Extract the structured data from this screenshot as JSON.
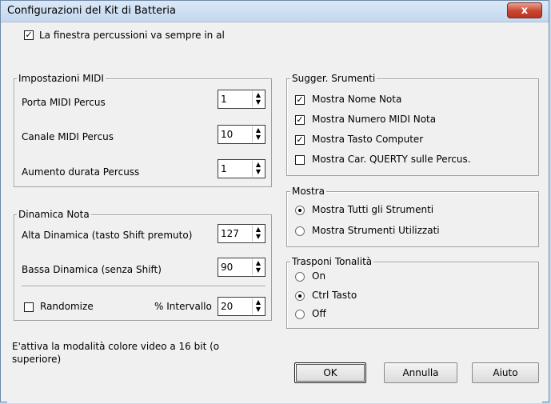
{
  "window": {
    "title": "Configurazioni del Kit di Batteria",
    "close_icon": "x"
  },
  "top_checkbox": {
    "label": "La finestra percussioni va sempre in al",
    "checked": true
  },
  "midi": {
    "legend": "Impostazioni MIDI",
    "port_label": "Porta MIDI Percus",
    "port_value": "1",
    "channel_label": "Canale MIDI Percus",
    "channel_value": "10",
    "duration_label": "Aumento durata Percuss",
    "duration_value": "1"
  },
  "dynamics": {
    "legend": "Dinamica Nota",
    "high_label": "Alta Dinamica (tasto Shift premuto)",
    "high_value": "127",
    "low_label": "Bassa Dinamica (senza Shift)",
    "low_value": "90",
    "randomize_label": "Randomize",
    "randomize_checked": false,
    "interval_label": "% Intervallo",
    "interval_value": "20"
  },
  "tips": {
    "legend": "Sugger. Srumenti",
    "items": [
      {
        "label": "Mostra Nome Nota",
        "checked": true
      },
      {
        "label": "Mostra Numero MIDI Nota",
        "checked": true
      },
      {
        "label": "Mostra Tasto Computer",
        "checked": true
      },
      {
        "label": "Mostra Car. QUERTY sulle Percus.",
        "checked": false
      }
    ]
  },
  "show": {
    "legend": "Mostra",
    "options": [
      {
        "label": "Mostra Tutti gli Strumenti",
        "selected": true
      },
      {
        "label": "Mostra Strumenti Utilizzati",
        "selected": false
      }
    ]
  },
  "transpose": {
    "legend": "Trasponi Tonalità",
    "options": [
      {
        "label": "On",
        "selected": false
      },
      {
        "label": "Ctrl Tasto",
        "selected": true
      },
      {
        "label": "Off",
        "selected": false
      }
    ]
  },
  "note": "E'attiva la modalità colore video a 16 bit (o superiore)",
  "buttons": {
    "ok": "OK",
    "cancel": "Annulla",
    "help": "Aiuto"
  },
  "check_glyph": "✓",
  "spin_glyph_up": "▲",
  "spin_glyph_down": "▼"
}
